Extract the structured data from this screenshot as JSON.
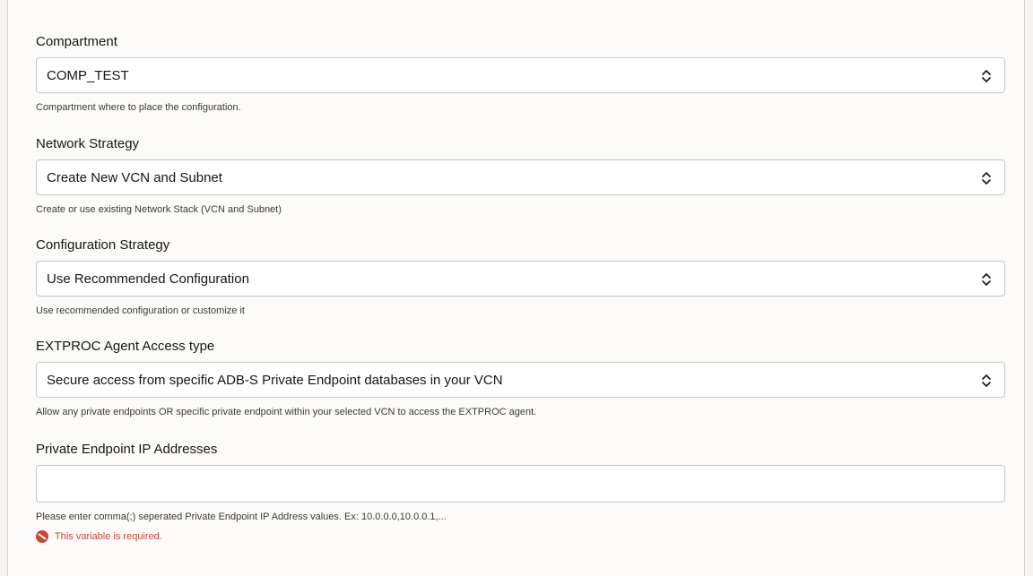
{
  "form": {
    "compartment": {
      "label": "Compartment",
      "value": "COMP_TEST",
      "help": "Compartment where to place the configuration."
    },
    "network_strategy": {
      "label": "Network Strategy",
      "value": "Create New VCN and Subnet",
      "help": "Create or use existing Network Stack (VCN and Subnet)"
    },
    "configuration_strategy": {
      "label": "Configuration Strategy",
      "value": "Use Recommended Configuration",
      "help": "Use recommended configuration or customize it"
    },
    "extproc_access_type": {
      "label": "EXTPROC Agent Access type",
      "value": "Secure access from specific ADB-S Private Endpoint databases in your VCN",
      "help": "Allow any private endpoints OR specific private endpoint within your selected VCN to access the EXTPROC agent."
    },
    "private_endpoint_ips": {
      "label": "Private Endpoint IP Addresses",
      "value": "",
      "placeholder": "",
      "help": "Please enter comma(;) seperated Private Endpoint IP Address values. Ex: 10.0.0.0,10.0.0.1,...",
      "error": "This variable is required."
    }
  },
  "icons": {
    "select_chevron": "chevron-up-down-icon",
    "error": "prohibited-icon"
  },
  "colors": {
    "error": "#c74634",
    "border": "#c9c6c1",
    "text": "#161513"
  }
}
